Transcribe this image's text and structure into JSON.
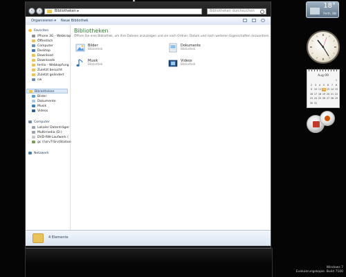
{
  "explorer": {
    "address": "Bibliotheken",
    "search_placeholder": "Bibliotheken durchsuchen",
    "toolbar": {
      "organize": "Organisieren ▾",
      "new_library": "Neue Bibliothek"
    },
    "nav": {
      "favorites_header": "Favoriten",
      "favorites": [
        "iPhone 3G - Webkrap",
        "Öffentlich",
        "Computer",
        "Desktop",
        "Download",
        "Downloads",
        "tertio - Webkopfung",
        "Zuletzt besucht",
        "Zuletzt geändert",
        "cw"
      ],
      "libraries_header": "Bibliotheken",
      "libraries": [
        "Bilder",
        "Dokumente",
        "Musik",
        "Videos"
      ],
      "computer_header": "Computer",
      "computer": [
        "Lokaler Datenträger",
        "Multimedia (D:)",
        "DVD-RW-Laufwerk (",
        "gc (\\\\srv7\\Srv|Station"
      ],
      "network": "Netzwerk"
    },
    "main": {
      "title": "Bibliotheken",
      "description": "Öffnen Sie eine Bibliothek, um Ihre Dateien anzuzeigen und sie nach Ordner, Datum und nach weiteren Eigenschaften anzuordnen.",
      "libraries": [
        {
          "name": "Bilder",
          "sub": "Bibliothek",
          "icon": "pictures-icon"
        },
        {
          "name": "Dokumente",
          "sub": "Bibliothek",
          "icon": "documents-icon"
        },
        {
          "name": "Musik",
          "sub": "Bibliothek",
          "icon": "music-icon"
        },
        {
          "name": "Videos",
          "sub": "Bibliothek",
          "icon": "videos-icon"
        }
      ]
    },
    "status": "4 Elemente"
  },
  "gadgets": {
    "weather": {
      "temp": "18°",
      "city": "Perth, BN"
    },
    "calendar": {
      "month": "Aug 09",
      "days": [
        "",
        "",
        "",
        "",
        "",
        "",
        "1",
        "2",
        "3",
        "4",
        "5",
        "6",
        "7",
        "8",
        "9",
        "10",
        "11",
        "12",
        "13",
        "14",
        "15",
        "16",
        "17",
        "18",
        "19",
        "20",
        "21",
        "22",
        "23",
        "24",
        "25",
        "26",
        "27",
        "28",
        "29",
        "30",
        "31",
        "",
        "",
        "",
        "",
        ""
      ],
      "today": "12",
      "today_color": "#e8a23a"
    }
  },
  "taskbar_info": {
    "line1": "Windows 7",
    "line2": "Evaluierungskopie. Build 7100"
  },
  "colors": {
    "accent_green": "#2d7a2d",
    "folder_yellow": "#e9c25c"
  }
}
